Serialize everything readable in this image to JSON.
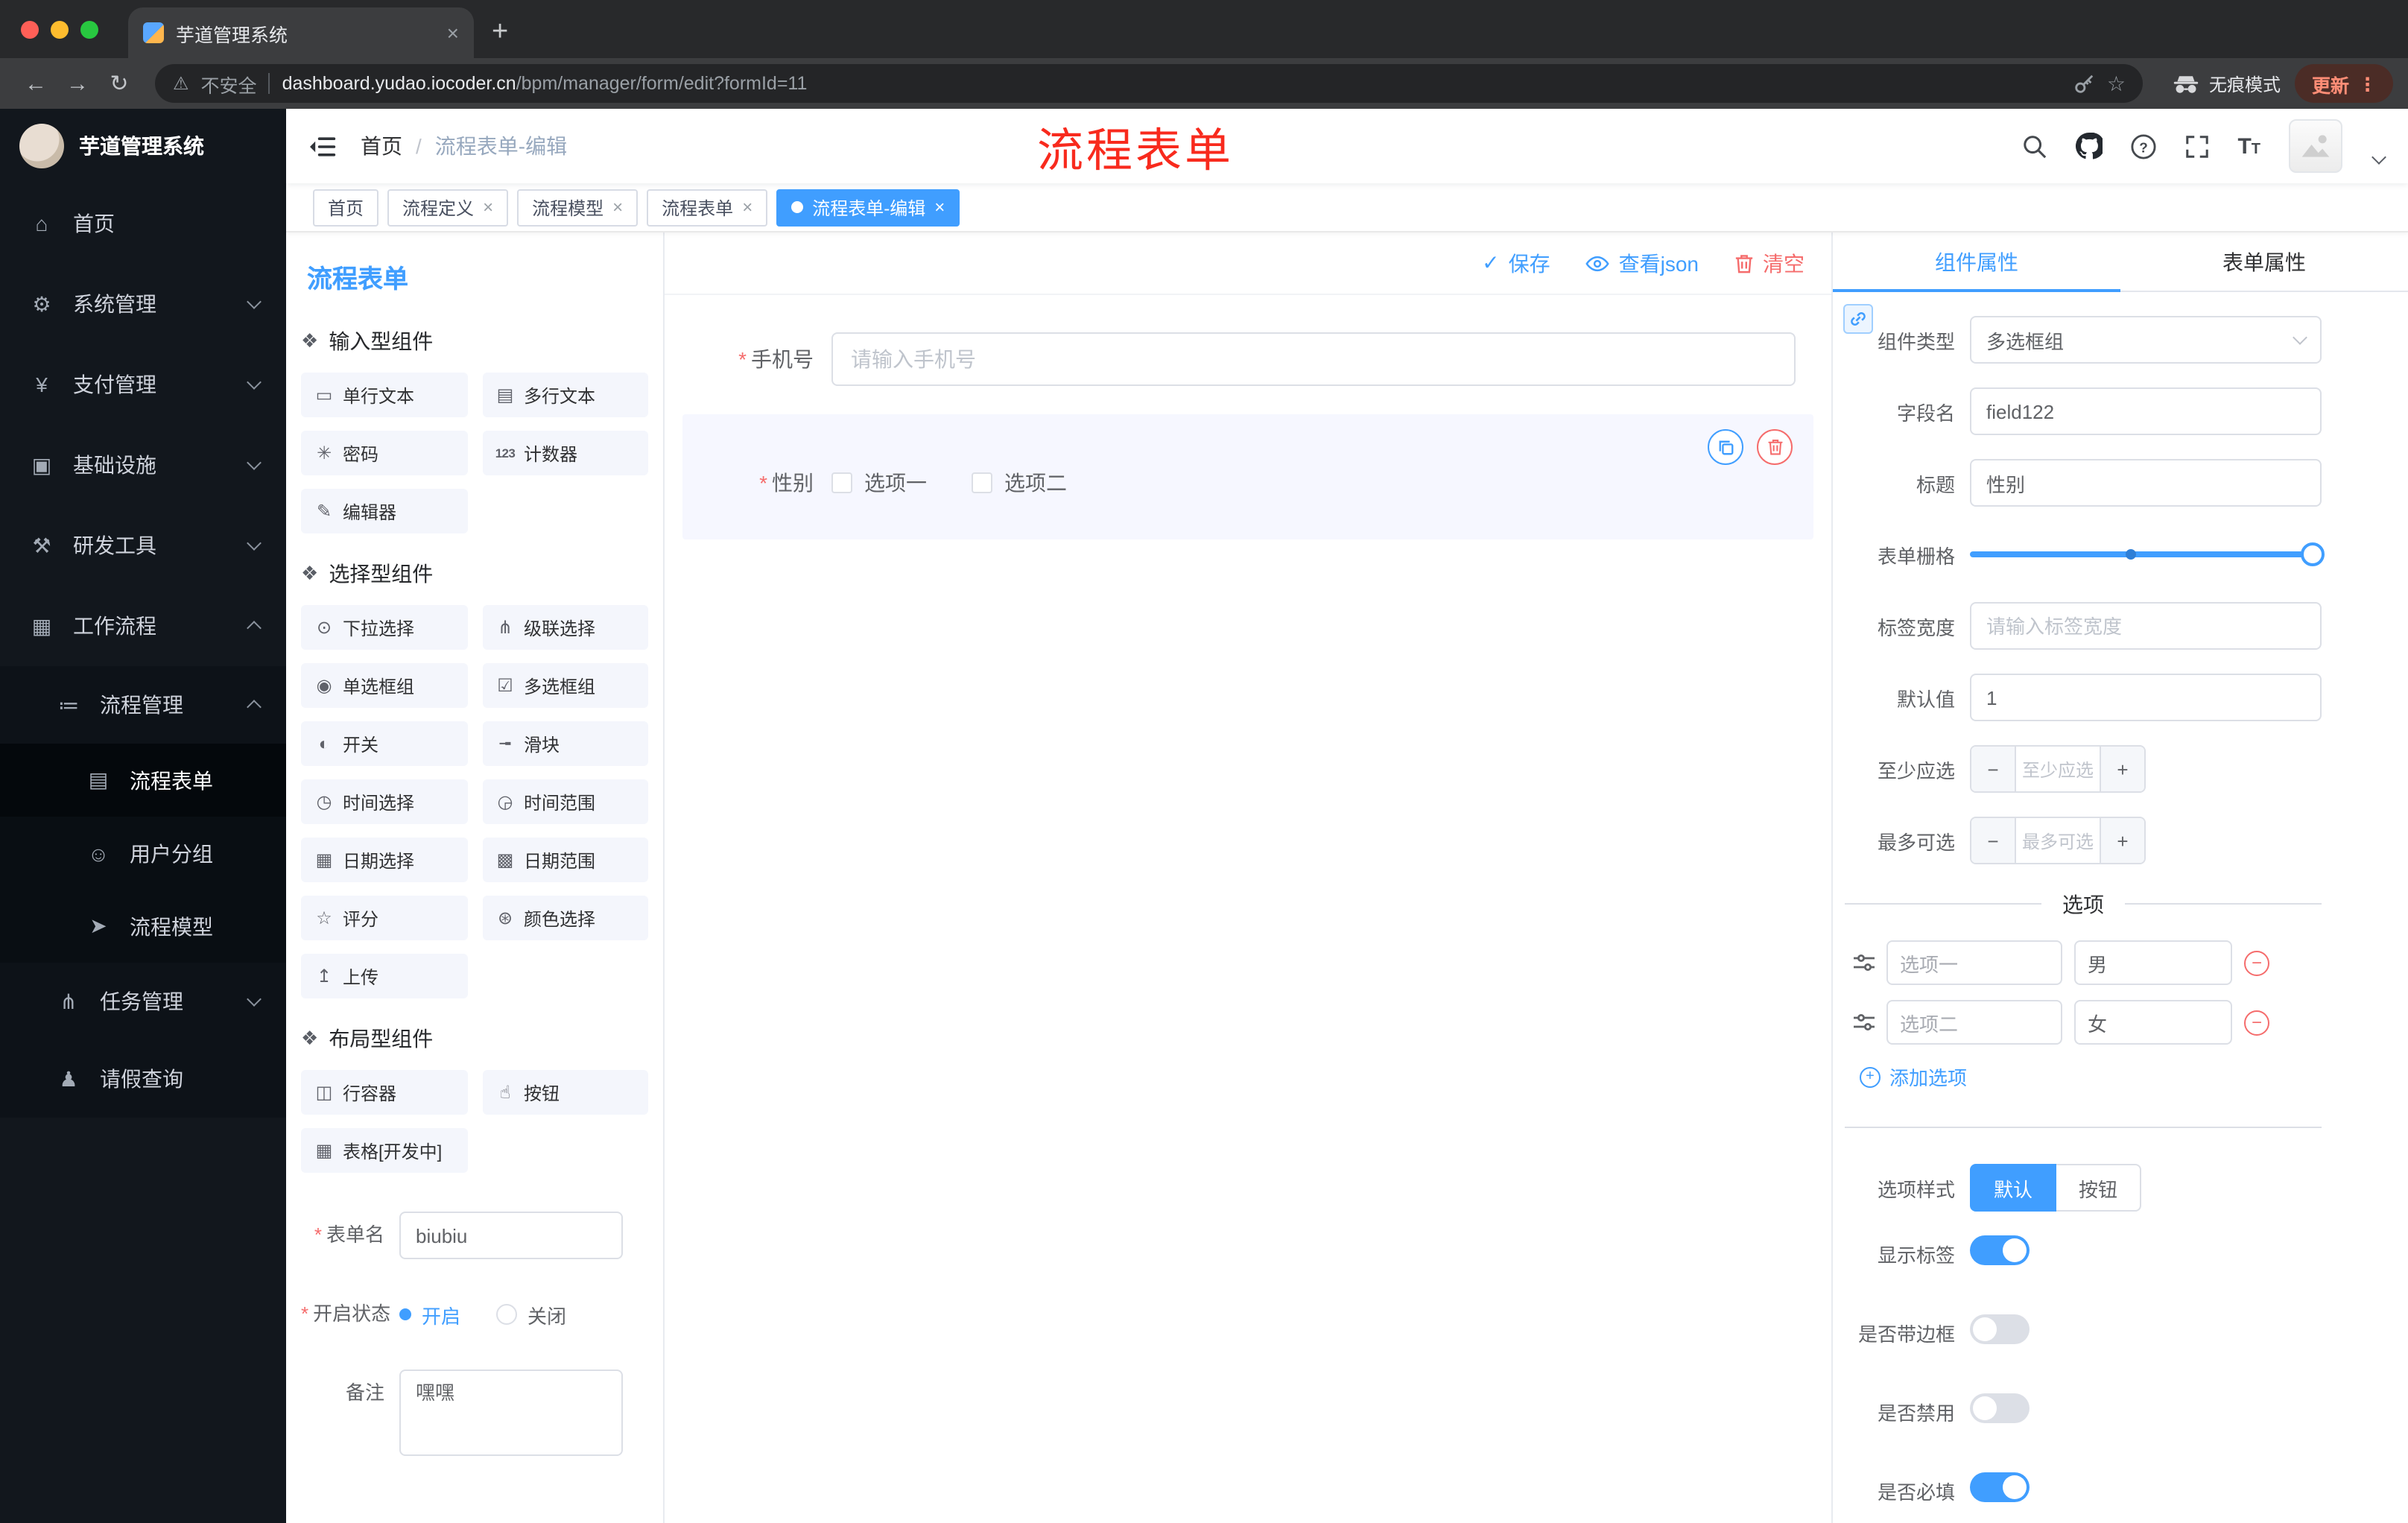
{
  "accent": {
    "blue": "#409eff",
    "red": "#f56c6c"
  },
  "browser": {
    "tab_title": "芋道管理系统",
    "security_label": "不安全",
    "url_domain": "dashboard.yudao.iocoder.cn",
    "url_path": "/bpm/manager/form/edit?formId=11",
    "incognito_label": "无痕模式",
    "update_label": "更新"
  },
  "icons": {
    "back": "←",
    "forward": "→",
    "reload": "↻",
    "warning": "⚠",
    "star": "☆",
    "overflow": "⋮",
    "close": "×",
    "plus": "+",
    "minus": "−",
    "check": "✓",
    "question": "?",
    "font_big": "T",
    "font_small": "T",
    "home": "⌂",
    "gear": "⚙",
    "yen": "¥",
    "infra": "▣",
    "tools": "⚒",
    "flow": "▦",
    "list": "≔",
    "doc": "▤",
    "chat": "☺",
    "send": "➤",
    "branch": "⋔",
    "person": "♟",
    "component": "❖",
    "chip": {
      "text": "▭",
      "textarea": "▤",
      "password": "✳",
      "counter": "123",
      "editor": "✎",
      "select": "⊙",
      "cascader": "⋔",
      "radio": "◉",
      "checkbox": "☑",
      "switch": "◐",
      "slider": "╼",
      "time": "◷",
      "time_range": "◶",
      "date": "▦",
      "date_range": "▩",
      "rate": "☆",
      "color": "⊛",
      "upload": "↥",
      "row": "◫",
      "button": "☝",
      "table": "▦"
    }
  },
  "sidebar": {
    "logo_title": "芋道管理系统",
    "items": [
      "首页",
      "系统管理",
      "支付管理",
      "基础设施",
      "研发工具",
      "工作流程",
      "流程管理",
      "流程表单",
      "用户分组",
      "流程模型",
      "任务管理",
      "请假查询"
    ]
  },
  "header": {
    "breadcrumb_home": "首页",
    "breadcrumb_sep": "/",
    "breadcrumb_current": "流程表单-编辑",
    "annotation": "流程表单"
  },
  "tags": [
    "首页",
    "流程定义",
    "流程模型",
    "流程表单",
    "流程表单-编辑"
  ],
  "designer": {
    "title": "流程表单",
    "save": "保存",
    "view_json": "查看json",
    "clear": "清空"
  },
  "palette": {
    "group1_title": "输入型组件",
    "group1": [
      "单行文本",
      "多行文本",
      "密码",
      "计数器",
      "编辑器"
    ],
    "group2_title": "选择型组件",
    "group2": [
      "下拉选择",
      "级联选择",
      "单选框组",
      "多选框组",
      "开关",
      "滑块",
      "时间选择",
      "时间范围",
      "日期选择",
      "日期范围",
      "评分",
      "颜色选择",
      "上传"
    ],
    "group3_title": "布局型组件",
    "group3": [
      "行容器",
      "按钮",
      "表格[开发中]"
    ]
  },
  "form_meta": {
    "name_label": "表单名",
    "name_value": "biubiu",
    "status_label": "开启状态",
    "status_on": "开启",
    "status_off": "关闭",
    "remark_label": "备注",
    "remark_value": "嘿嘿"
  },
  "canvas": {
    "phone_label": "手机号",
    "phone_placeholder": "请输入手机号",
    "gender_label": "性别",
    "option1": "选项一",
    "option2": "选项二"
  },
  "props": {
    "tab_component": "组件属性",
    "tab_form": "表单属性",
    "type_label": "组件类型",
    "type_value": "多选框组",
    "field_label": "字段名",
    "field_value": "field122",
    "title_label": "标题",
    "title_value": "性别",
    "grid_label": "表单栅格",
    "width_label": "标签宽度",
    "width_placeholder": "请输入标签宽度",
    "default_label": "默认值",
    "default_value": "1",
    "min_label": "至少应选",
    "min_placeholder": "至少应选",
    "max_label": "最多可选",
    "max_placeholder": "最多可选",
    "options_title": "选项",
    "opt_rows": [
      {
        "name": "选项一",
        "value": "男"
      },
      {
        "name": "选项二",
        "value": "女"
      }
    ],
    "add_option": "添加选项",
    "style_label": "选项样式",
    "style_default": "默认",
    "style_button": "按钮",
    "switch_show_label": "显示标签",
    "switch_border": "是否带边框",
    "switch_disabled": "是否禁用",
    "switch_required": "是否必填"
  }
}
